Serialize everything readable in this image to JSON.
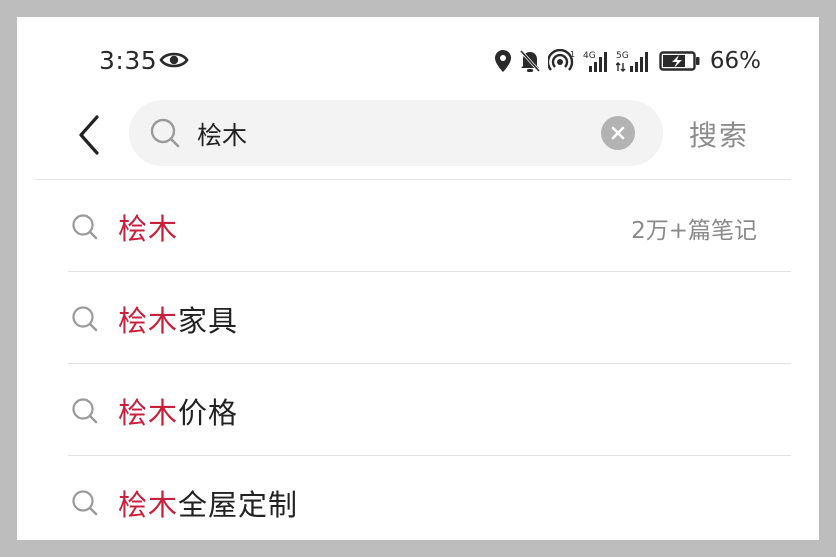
{
  "status_bar": {
    "time": "3:35",
    "battery_percent": "66%",
    "signal_1_label": "4G",
    "signal_2_label": "5G",
    "icons": [
      "eye-icon",
      "location-icon",
      "bell-off-icon",
      "hotspot-icon",
      "signal-icon",
      "battery-charging-icon"
    ]
  },
  "search": {
    "value": "桧木",
    "submit_label": "搜索",
    "icons": [
      "back-chevron-icon",
      "search-icon",
      "clear-icon"
    ]
  },
  "suggestions": [
    {
      "highlight": "桧木",
      "rest": "",
      "count": "2万+篇笔记"
    },
    {
      "highlight": "桧木",
      "rest": "家具",
      "count": ""
    },
    {
      "highlight": "桧木",
      "rest": "价格",
      "count": ""
    },
    {
      "highlight": "桧木",
      "rest": "全屋定制",
      "count": ""
    }
  ],
  "colors": {
    "highlight": "#c8213d",
    "muted": "#8c8c8c",
    "search_bg": "#f3f3f3",
    "frame_bg": "#bdbdbd"
  }
}
